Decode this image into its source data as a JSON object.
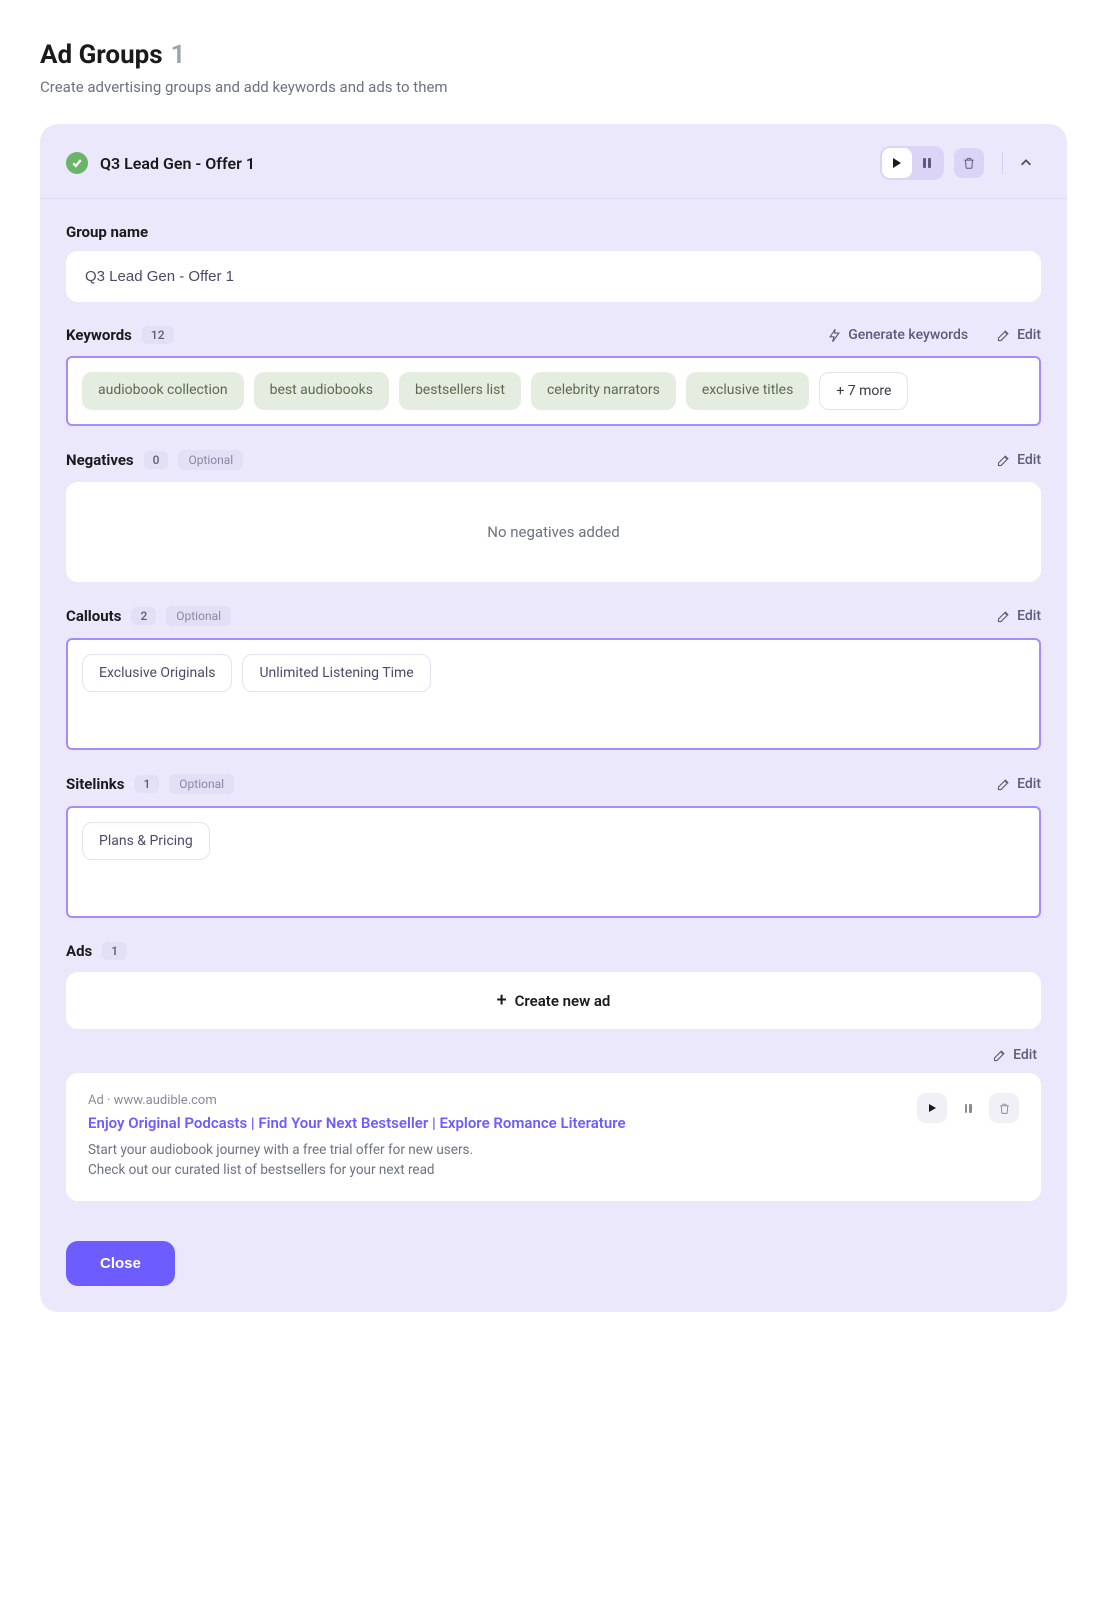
{
  "page": {
    "title": "Ad Groups",
    "count": "1",
    "subtitle": "Create advertising groups and add keywords and ads to them"
  },
  "group": {
    "name": "Q3 Lead Gen - Offer 1",
    "groupNameLabel": "Group name",
    "groupNameValue": "Q3 Lead Gen - Offer 1"
  },
  "keywords": {
    "label": "Keywords",
    "count": "12",
    "generateLabel": "Generate keywords",
    "editLabel": "Edit",
    "chips": [
      "audiobook collection",
      "best audiobooks",
      "bestsellers list",
      "celebrity narrators",
      "exclusive titles"
    ],
    "more": "+ 7 more"
  },
  "negatives": {
    "label": "Negatives",
    "count": "0",
    "optional": "Optional",
    "editLabel": "Edit",
    "empty": "No negatives added"
  },
  "callouts": {
    "label": "Callouts",
    "count": "2",
    "optional": "Optional",
    "editLabel": "Edit",
    "chips": [
      "Exclusive Originals",
      "Unlimited Listening Time"
    ]
  },
  "sitelinks": {
    "label": "Sitelinks",
    "count": "1",
    "optional": "Optional",
    "editLabel": "Edit",
    "chips": [
      "Plans & Pricing"
    ]
  },
  "ads": {
    "label": "Ads",
    "count": "1",
    "createLabel": "Create new ad",
    "editLabel": "Edit",
    "card": {
      "metaPrefix": "Ad",
      "metaSep": " · ",
      "domain": "www.audible.com",
      "headline": "Enjoy Original Podcasts | Find Your Next Bestseller | Explore Romance Literature",
      "line1": "Start your audiobook journey with a free trial offer for new users.",
      "line2": "Check out our curated list of bestsellers for your next read"
    }
  },
  "actions": {
    "close": "Close"
  }
}
